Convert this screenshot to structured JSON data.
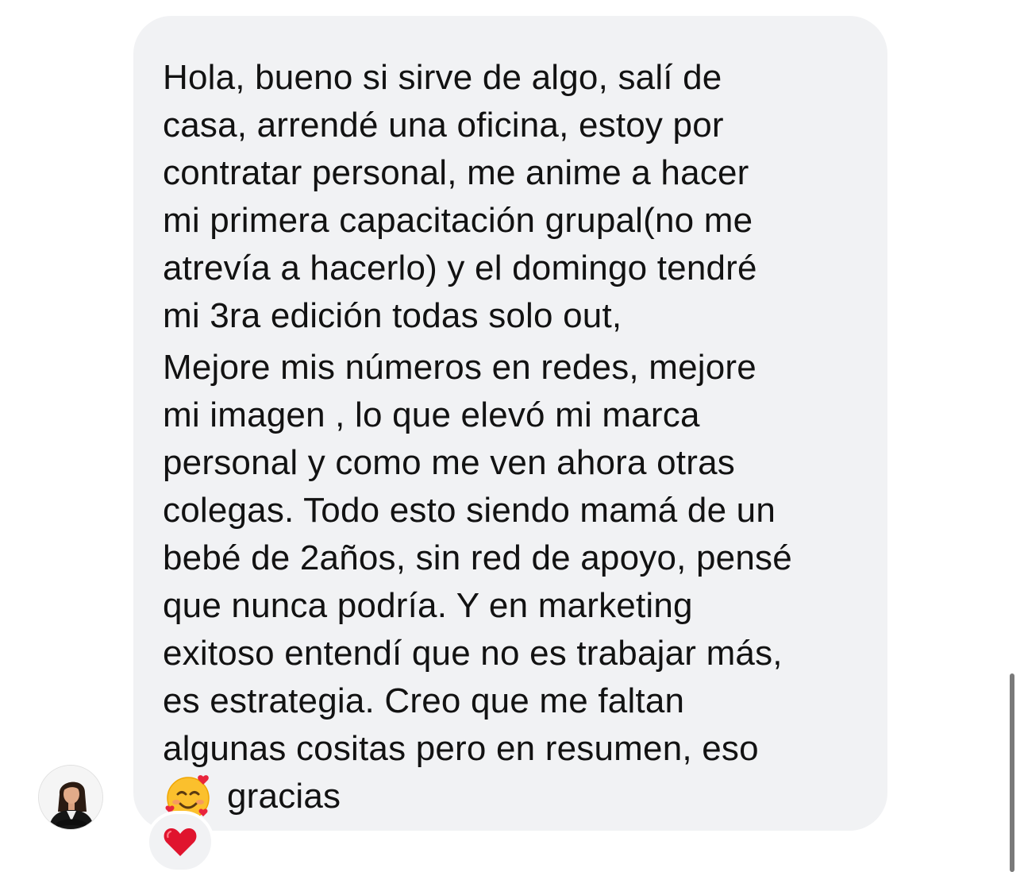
{
  "message": {
    "lines": [
      "Hola, bueno si sirve de algo, salí de",
      "casa, arrendé una oficina, estoy por",
      "contratar personal, me anime a hacer",
      "mi primera capacitación grupal(no me",
      "atrevía a hacerlo) y el domingo tendré",
      "mi 3ra edición todas solo out,",
      "Mejore mis números en redes, mejore",
      "mi imagen , lo que elevó mi marca",
      "personal y como me ven ahora otras",
      "colegas. Todo esto siendo mamá de un",
      "bebé de 2años, sin red de apoyo, pensé",
      "que nunca podría. Y en marketing",
      "exitoso entendí que no es trabajar más,",
      "es estrategia. Creo que me faltan",
      "algunas cositas pero en resumen, eso"
    ],
    "last_line_emoji": "smiling-face-with-hearts-icon",
    "last_line_text": "gracias"
  },
  "reaction": {
    "emoji": "red-heart-icon"
  },
  "colors": {
    "bubble_background": "#f1f2f4",
    "text": "#121212",
    "heart": "#e0142e",
    "emoji_face": "#fbc02d"
  }
}
